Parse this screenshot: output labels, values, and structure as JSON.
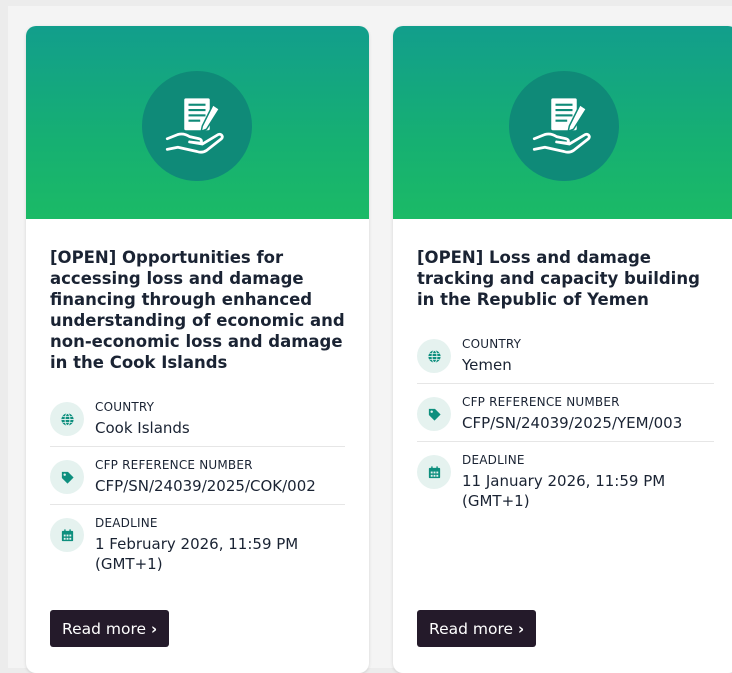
{
  "cards": [
    {
      "title": "[OPEN] Opportunities for accessing loss and damage financing through enhanced understanding of economic and non-economic loss and damage in the Cook Islands",
      "country_label": "COUNTRY",
      "country_value": "Cook Islands",
      "ref_label": "CFP REFERENCE NUMBER",
      "ref_value": "CFP/SN/24039/2025/COK/002",
      "deadline_label": "DEADLINE",
      "deadline_value": "1 February 2026, 11:59 PM (GMT+1)",
      "button_label": "Read more",
      "button_chevron": "›"
    },
    {
      "title": "[OPEN] Loss and damage tracking and capacity building in the Republic of Yemen",
      "country_label": "COUNTRY",
      "country_value": "Yemen",
      "ref_label": "CFP REFERENCE NUMBER",
      "ref_value": "CFP/SN/24039/2025/YEM/003",
      "deadline_label": "DEADLINE",
      "deadline_value": "11 January 2026, 11:59 PM (GMT+1)",
      "button_label": "Read more",
      "button_chevron": "›"
    }
  ],
  "icons": {
    "banner": "document-hand-pen-icon",
    "country": "globe-icon",
    "reference": "tag-icon",
    "deadline": "calendar-icon"
  },
  "colors": {
    "banner_gradient_top": "#129e8c",
    "banner_gradient_bottom": "#1bba66",
    "banner_circle": "#0f8a78",
    "accent_icon": "#0e8f7e",
    "button_bg": "#241a2a"
  }
}
